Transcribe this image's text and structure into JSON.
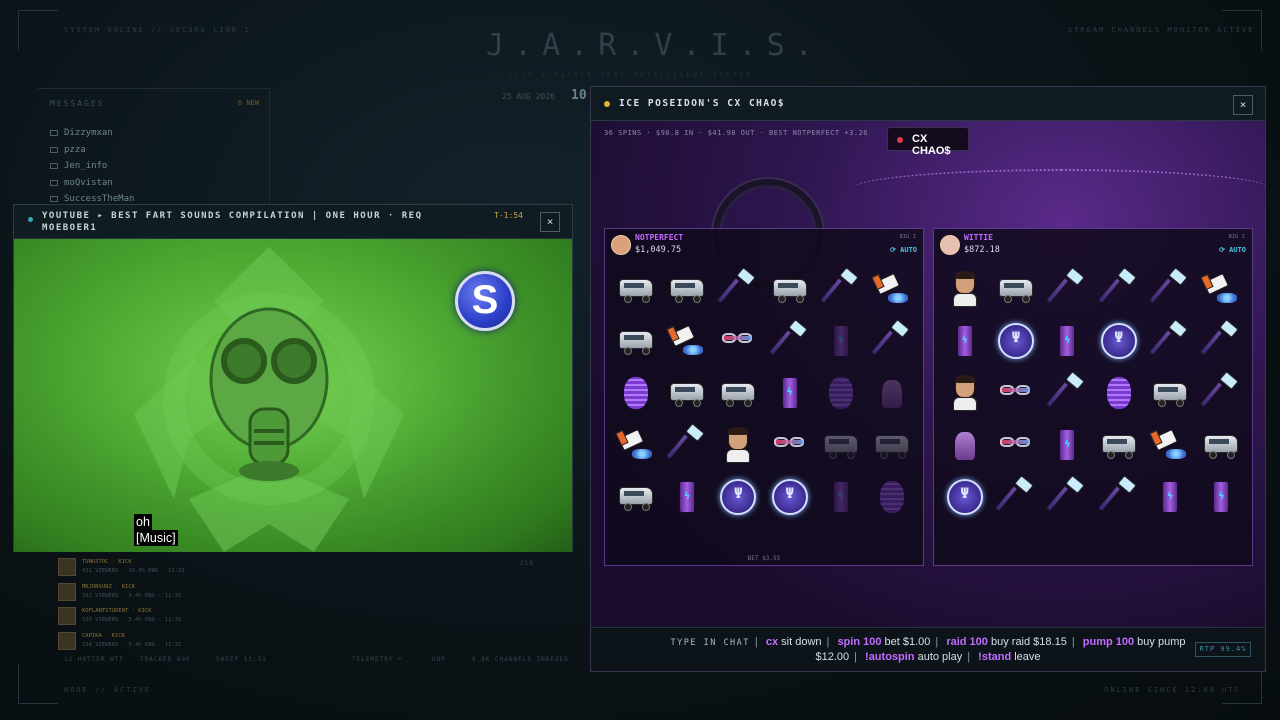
{
  "hud": {
    "title": "J.A.R.V.I.S.",
    "subtitle": "JUST A RATHER VERY INTELLIGENT SYSTEM",
    "date": "25 AUG 2026",
    "time": "10",
    "top_left": "SYSTEM ONLINE // SECURE LINK 1",
    "top_right": "STREAM CHANNELS MONITOR ACTIVE",
    "bottom_left": "NODE // ACTIVE",
    "bottom_right": "ONLINE SINCE 12:00 UTC"
  },
  "messages": {
    "heading": "MESSAGES",
    "badge": "6 NEW",
    "items": [
      "Dizzymxan",
      "pzza",
      "Jen_info",
      "moQvistan",
      "SuccessTheMan"
    ]
  },
  "streams": [
    {
      "name": "TUNGSTOC · KICK",
      "meta": "431 VIEWERS · 10.0% ENG · 11:31"
    },
    {
      "name": "MRJONSUNZ · KICK",
      "meta": "332 VIEWERS · 9.4% ENG · 11:31"
    },
    {
      "name": "KOFLANTSTUDENT · KICK",
      "meta": "130 VIEWERS · 5.4% ENG · 11:31"
    },
    {
      "name": "CAPIKA · KICK",
      "meta": "124 VIEWERS · 5.4% ENG · 11:31"
    }
  ],
  "bottom_bar": {
    "left": "12 HOTTER WTF",
    "mid": "TRACKED 69K",
    "sweep": "SWEEP 11:31",
    "telemetry": "TELEMETRY +",
    "udp": "UDP",
    "channels": "6.8K CHANNELS INDEXED",
    "count": "218"
  },
  "youtube": {
    "title": "YOUTUBE ▸ BEST FART SOUNDS COMPILATION | ONE HOUR · REQ MOEBOER1",
    "timer": "T-1:54",
    "close": "×",
    "caption_1": "oh",
    "caption_2": "[Music]",
    "logo_letter": "S"
  },
  "slot": {
    "title": "ICE POSEIDON'S CX CHAO$",
    "close": "×",
    "stats": "36 SPINS  ·  $90.8 IN  ·  $41.98 OUT  ·  BEST NOTPERFECT +3.26",
    "badge": "CX CHAO$",
    "players": [
      {
        "name": "NOTPERFECT",
        "balance": "$1,049.75",
        "tag": "BIG 1",
        "auto": "⟳ AUTO",
        "bet": "BET $3.55",
        "grid": [
          [
            "rv",
            "rv",
            "mic",
            "rv",
            "mic",
            "pills"
          ],
          [
            "rv",
            "pills",
            "glass",
            "mic",
            "can*",
            "mic"
          ],
          [
            "brain",
            "rv",
            "rv",
            "can",
            "brain*",
            "hand*"
          ],
          [
            "pills",
            "mic",
            "face",
            "glass",
            "rv*",
            "rv*"
          ],
          [
            "rv",
            "can",
            "coin",
            "coin",
            "can*",
            "brain*"
          ]
        ]
      },
      {
        "name": "WITTIE",
        "balance": "$872.18",
        "tag": "BIG 2",
        "auto": "⟳ AUTO",
        "grid": [
          [
            "face",
            "rv",
            "mic",
            "mic",
            "mic",
            "pills"
          ],
          [
            "can",
            "coin",
            "can",
            "coin",
            "mic",
            "mic"
          ],
          [
            "face",
            "glass",
            "mic",
            "brain",
            "rv",
            "mic"
          ],
          [
            "hand",
            "glass",
            "can",
            "rv",
            "pills",
            "rv"
          ],
          [
            "coin",
            "mic",
            "mic",
            "mic",
            "can",
            "can"
          ]
        ]
      }
    ],
    "chat": {
      "lead": "TYPE IN CHAT",
      "c1": "cx",
      "t1": "sit down",
      "c2": "spin 100",
      "t2": "bet $1.00",
      "c3": "raid 100",
      "t3": "buy raid $18.15",
      "c4": "pump 100",
      "t4": "buy pump",
      "price": "$12.00",
      "c5": "!autospin",
      "t5": "auto play",
      "c6": "!stand",
      "t6": "leave",
      "rtp": "RTP 99.4%"
    }
  }
}
